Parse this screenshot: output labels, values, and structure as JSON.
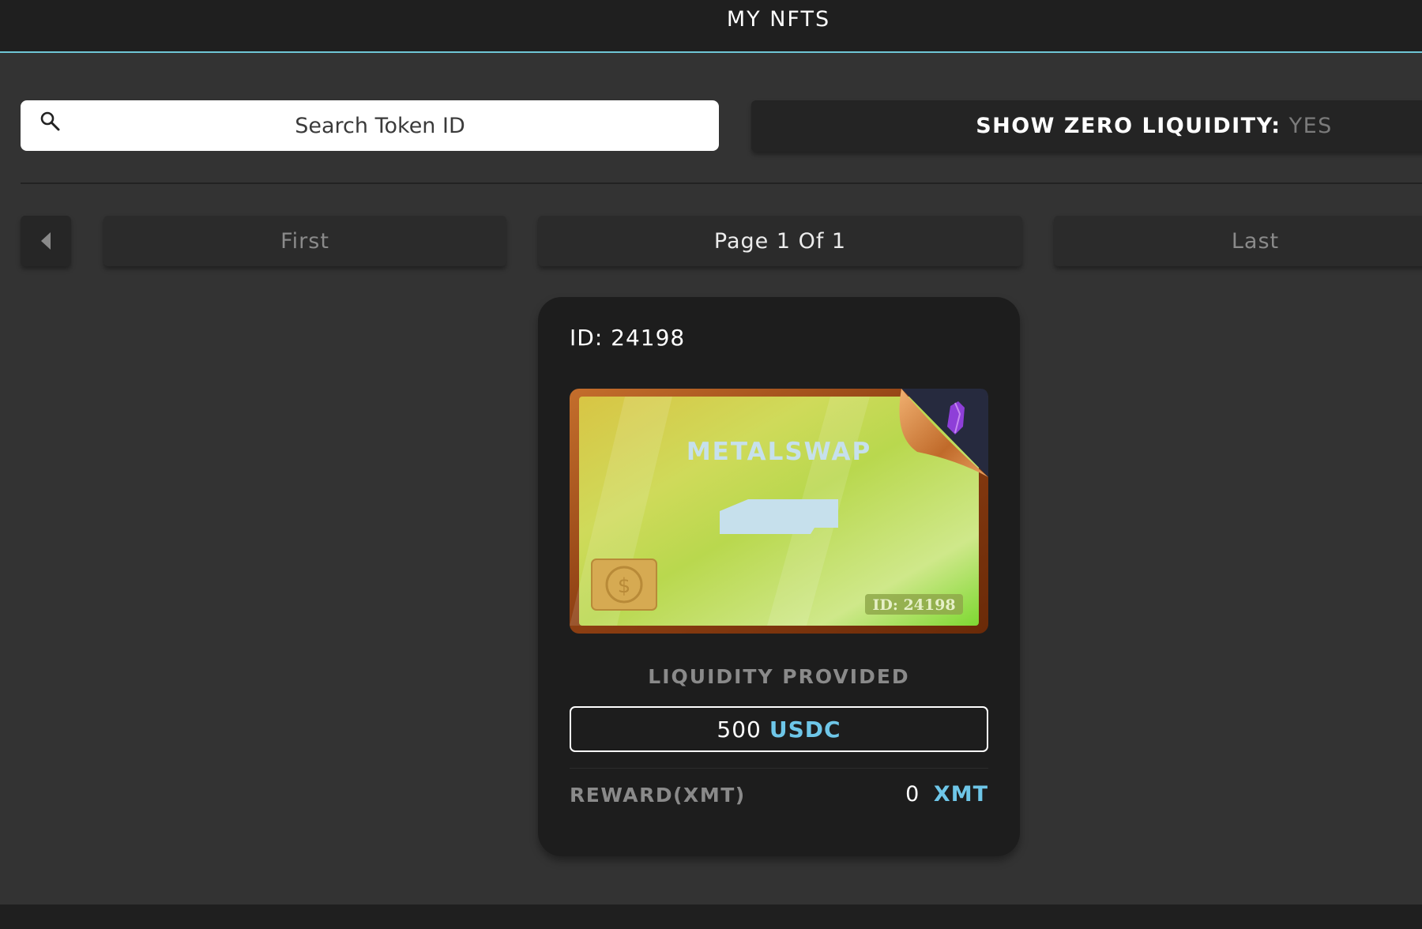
{
  "header": {
    "title": "MY NFTS"
  },
  "search": {
    "placeholder": "Search Token ID",
    "value": ""
  },
  "zero_liquidity": {
    "label": "SHOW ZERO LIQUIDITY:",
    "value": "YES"
  },
  "pagination": {
    "first_label": "First",
    "page_indicator": "Page 1 Of 1",
    "last_label": "Last"
  },
  "nft": {
    "id_label": "ID: 24198",
    "image": {
      "brand": "METALSWAP",
      "badge": "ID: 24198"
    },
    "liquidity_label": "LIQUIDITY PROVIDED",
    "liquidity_amount": "500",
    "liquidity_token": "USDC",
    "reward_label": "REWARD(XMT)",
    "reward_amount": "0",
    "reward_token": "XMT"
  },
  "colors": {
    "accent": "#6ec6e8",
    "header_border": "#6fc7d6",
    "background": "#333333",
    "card": "#1d1d1d"
  },
  "icons": {
    "search": "search-icon",
    "prev": "caret-left-icon",
    "chip": "usdc-chip-icon",
    "gem": "purple-gem-icon"
  }
}
